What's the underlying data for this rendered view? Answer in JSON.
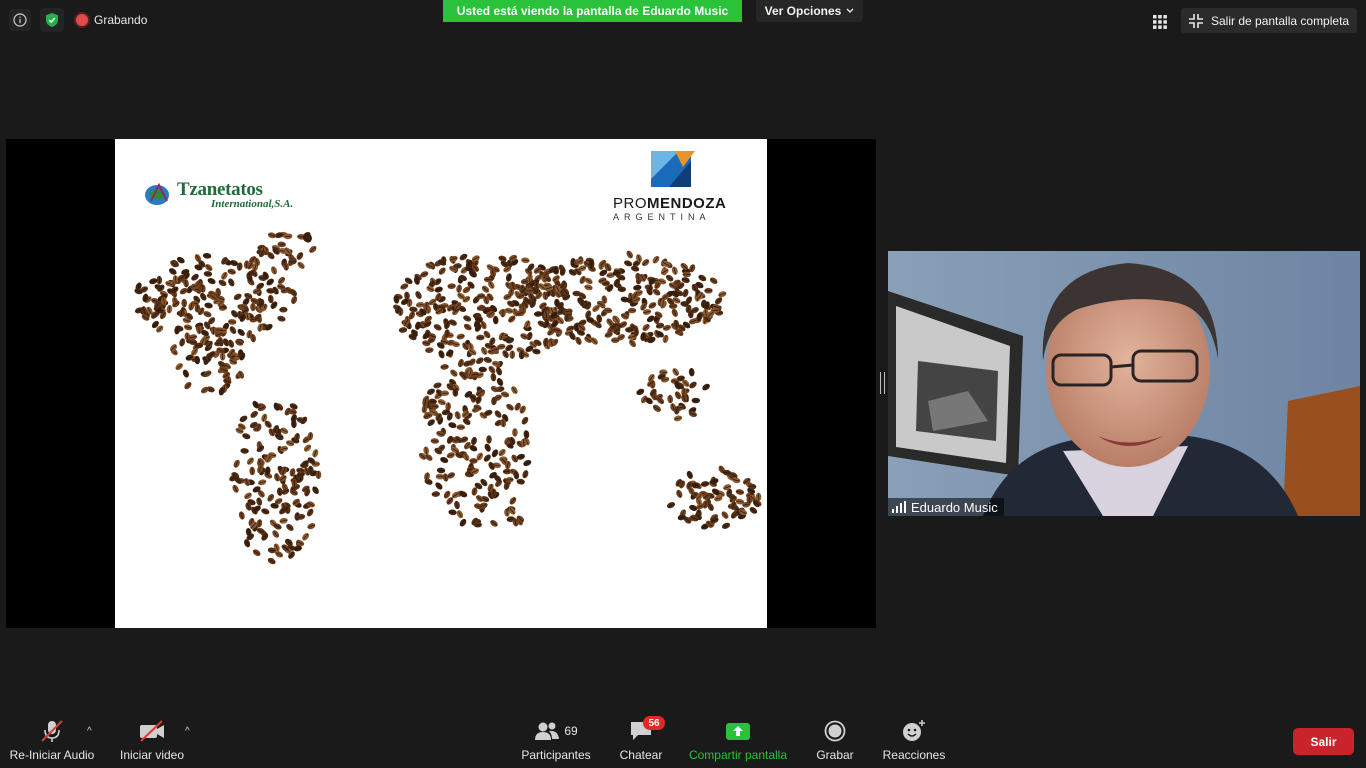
{
  "top_bar": {
    "recording_label": "Grabando",
    "banner_text": "Usted está viendo la pantalla de Eduardo Music",
    "options_label": "Ver Opciones",
    "exit_fullscreen_label": "Salir de pantalla completa"
  },
  "icons": {
    "info": "info-icon",
    "security": "shield-check-icon",
    "recording": "record-dot-icon",
    "chevron": "chevron-down-icon",
    "gallery": "grid-view-icon",
    "exit_fullscreen": "exit-fullscreen-icon"
  },
  "slide": {
    "logo_left_name": "Tzanetatos",
    "logo_left_sub": "International,S.A.",
    "logo_right_pro": "PRO",
    "logo_right_mendoza": "MENDOZA",
    "logo_right_sub": "ARGENTINA"
  },
  "video": {
    "participant_name": "Eduardo Music"
  },
  "toolbar": {
    "audio_label": "Re-Iniciar Audio",
    "video_label": "Iniciar video",
    "participants_label": "Participantes",
    "participants_count": "69",
    "chat_label": "Chatear",
    "chat_badge": "56",
    "share_label": "Compartir pantalla",
    "record_label": "Grabar",
    "reactions_label": "Reacciones",
    "leave_label": "Salir"
  },
  "colors": {
    "banner_green": "#2ac13b",
    "leave_red": "#c9242b",
    "badge_red": "#e02828",
    "background": "#1a1a1a"
  }
}
